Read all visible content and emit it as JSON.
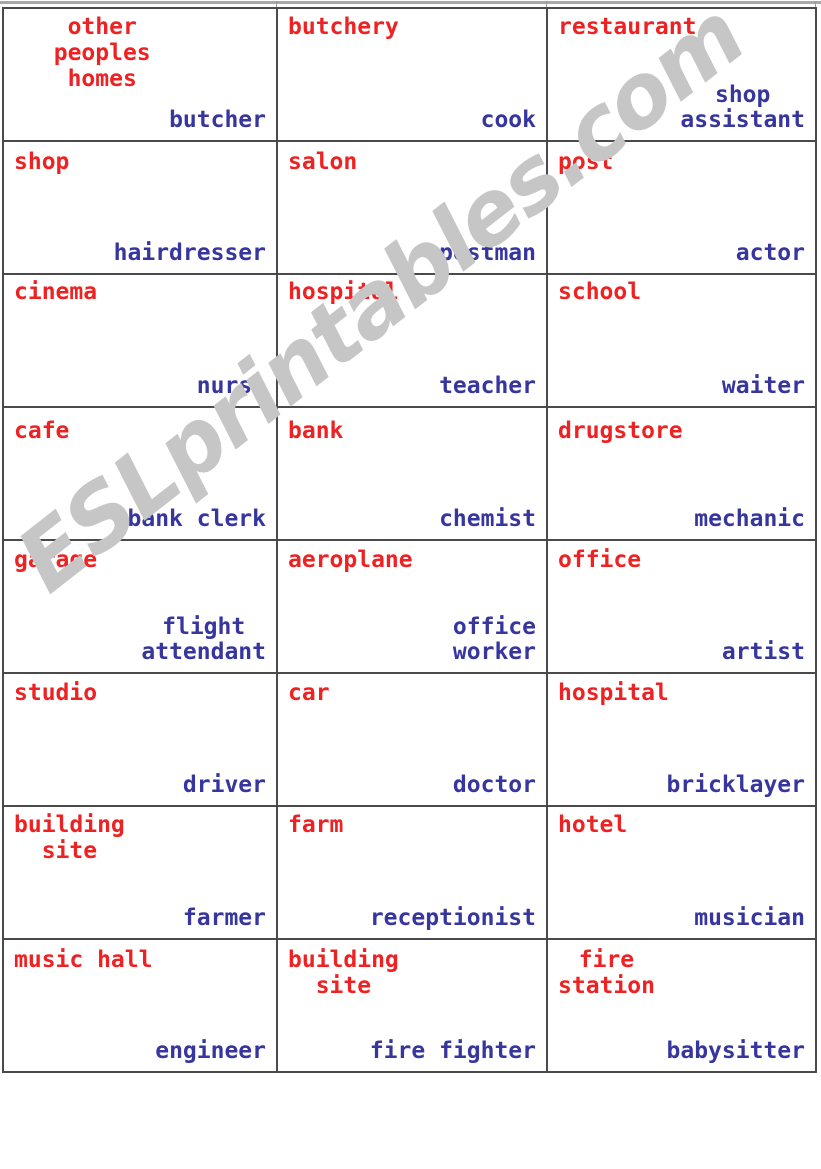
{
  "document": {
    "kind": "esl-flashcard-worksheet",
    "watermark": "ESLprintables.com",
    "colors": {
      "place_text": "#ee2222",
      "job_text": "#36369e",
      "grid_line": "#4a4a4a",
      "watermark": "#c6c6c6",
      "page_background": "#ffffff"
    }
  },
  "table": {
    "columns": 3,
    "rows": 8,
    "cells": [
      [
        {
          "place": "other peoples\nhomes",
          "job": "butcher"
        },
        {
          "place": "butchery",
          "job": "cook"
        },
        {
          "place": "restaurant",
          "job": "shop\nassistant"
        }
      ],
      [
        {
          "place": "shop",
          "job": "hairdresser"
        },
        {
          "place": "salon",
          "job": "postman"
        },
        {
          "place": "post",
          "job": "actor"
        }
      ],
      [
        {
          "place": "cinema",
          "job": "nurse"
        },
        {
          "place": "hospital",
          "job": "teacher"
        },
        {
          "place": "school",
          "job": "waiter"
        }
      ],
      [
        {
          "place": "cafe",
          "job": "bank clerk"
        },
        {
          "place": "bank",
          "job": "chemist"
        },
        {
          "place": "drugstore",
          "job": "mechanic"
        }
      ],
      [
        {
          "place": "garage",
          "job": "flight\nattendant"
        },
        {
          "place": "aeroplane",
          "job": "office\nworker"
        },
        {
          "place": "office",
          "job": "artist"
        }
      ],
      [
        {
          "place": "studio",
          "job": "driver"
        },
        {
          "place": "car",
          "job": "doctor"
        },
        {
          "place": "hospital",
          "job": "bricklayer"
        }
      ],
      [
        {
          "place": "building\nsite",
          "job": "farmer"
        },
        {
          "place": "farm",
          "job": "receptionist"
        },
        {
          "place": "hotel",
          "job": "musician"
        }
      ],
      [
        {
          "place": "music hall",
          "job": "engineer"
        },
        {
          "place": "building\nsite",
          "job": "fire fighter"
        },
        {
          "place": "fire\nstation",
          "job": "babysitter"
        }
      ]
    ]
  }
}
